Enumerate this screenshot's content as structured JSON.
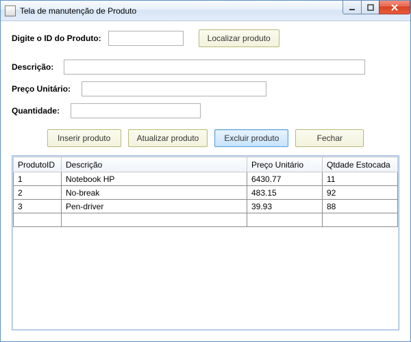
{
  "window": {
    "title": "Tela de manutenção de Produto"
  },
  "form": {
    "id_label": "Digite o ID do Produto:",
    "id_value": "",
    "locate_btn": "Localizar produto",
    "desc_label": "Descrição:",
    "desc_value": "",
    "price_label": "Preço Unitário:",
    "price_value": "",
    "qty_label": "Quantidade:",
    "qty_value": ""
  },
  "buttons": {
    "insert": "Inserir produto",
    "update": "Atualizar produto",
    "delete": "Excluir produto",
    "close": "Fechar"
  },
  "grid": {
    "headers": {
      "id": "ProdutoID",
      "desc": "Descrição",
      "price": "Preço Unitário",
      "qty": "Qtdade Estocada"
    },
    "rows": [
      {
        "id": "1",
        "desc": "Notebook HP",
        "price": "6430.77",
        "qty": "11"
      },
      {
        "id": "2",
        "desc": "No-break",
        "price": "483.15",
        "qty": "92"
      },
      {
        "id": "3",
        "desc": "Pen-driver",
        "price": "39.93",
        "qty": "88"
      }
    ]
  }
}
